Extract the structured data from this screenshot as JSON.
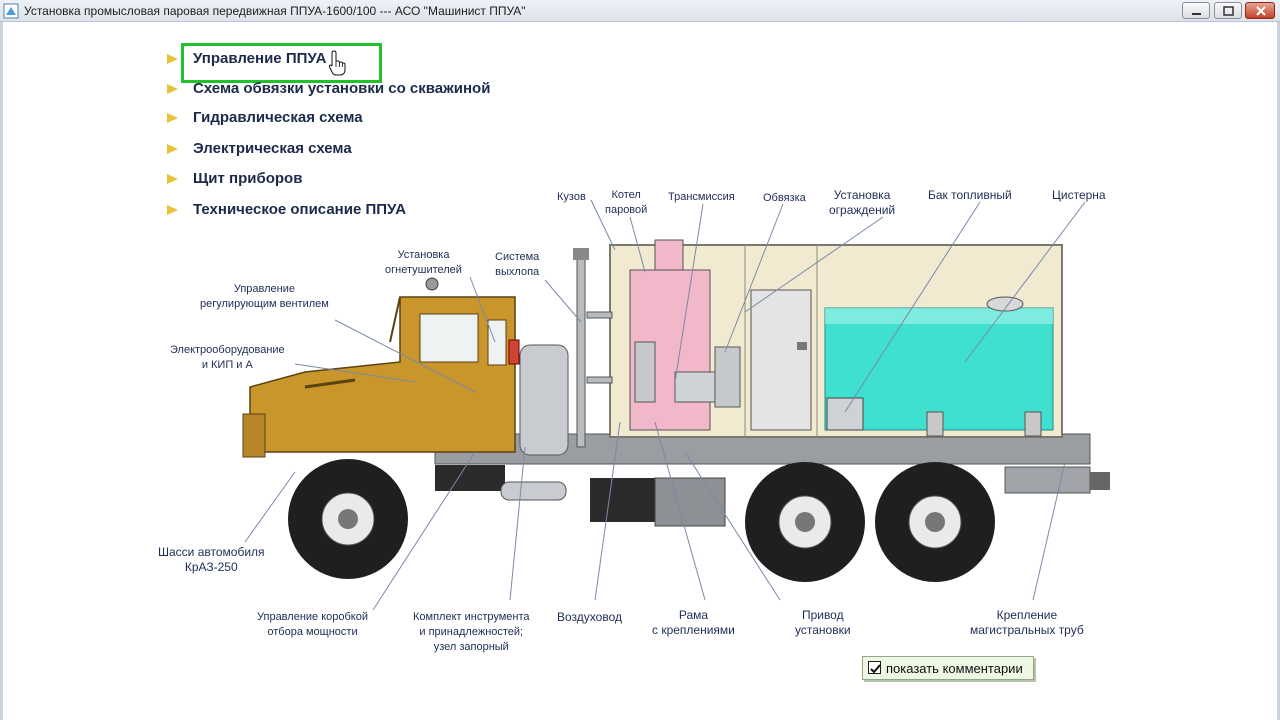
{
  "window": {
    "title": "Установка промысловая паровая передвижная ППУА-1600/100 --- АСО \"Машинист ППУА\"",
    "app_icon": "app-icon",
    "controls": [
      "minimize-icon",
      "maximize-icon",
      "close-icon"
    ]
  },
  "menu": {
    "items": [
      {
        "label": "Управление ППУА",
        "active": true
      },
      {
        "label": "Схема обвязки установки со скважиной"
      },
      {
        "label": "Гидравлическая схема"
      },
      {
        "label": "Электрическая схема"
      },
      {
        "label": "Щит приборов"
      },
      {
        "label": "Техническое описание ППУА"
      }
    ],
    "highlight_color": "#22c02a",
    "bullet_color": "#e7c23a"
  },
  "diagram": {
    "labels": {
      "kuzov": "Кузов",
      "kotel": [
        "Котел",
        "паровой"
      ],
      "transmissiya": "Трансмиссия",
      "obvyazka": "Обвязка",
      "ograzhdeniy": [
        "Установка",
        "ограждений"
      ],
      "bak": "Бак топливный",
      "cisterna": "Цистерна",
      "ognetush": [
        "Установка",
        "огнетушителей"
      ],
      "vyhlop": [
        "Система",
        "выхлопа"
      ],
      "ventil": [
        "Управление",
        "регулирующим вентилем"
      ],
      "electro": [
        "Электрооборудование",
        "и КИП и А"
      ],
      "shassi": [
        "Шасси автомобиля",
        "КрАЗ-250"
      ],
      "korobka": [
        "Управление коробкой",
        "отбора мощности"
      ],
      "komplekt": [
        "Комплект инструмента",
        "и принадлежностей;",
        "узел запорный"
      ],
      "vozduh": "Воздуховод",
      "rama": [
        "Рама",
        "с креплениями"
      ],
      "privod": [
        "Привод",
        "установки"
      ],
      "kreplenie": [
        "Крепление",
        "магистральных труб"
      ]
    },
    "colors": {
      "cab": "#c8962a",
      "tank": "#3fe0d0",
      "body": "#f1ead1",
      "boiler": "#f0b8c8",
      "chassis": "#8d9094",
      "label": "#1e2d55"
    }
  },
  "show_comments": {
    "label": "показать комментарии",
    "checked": true
  }
}
